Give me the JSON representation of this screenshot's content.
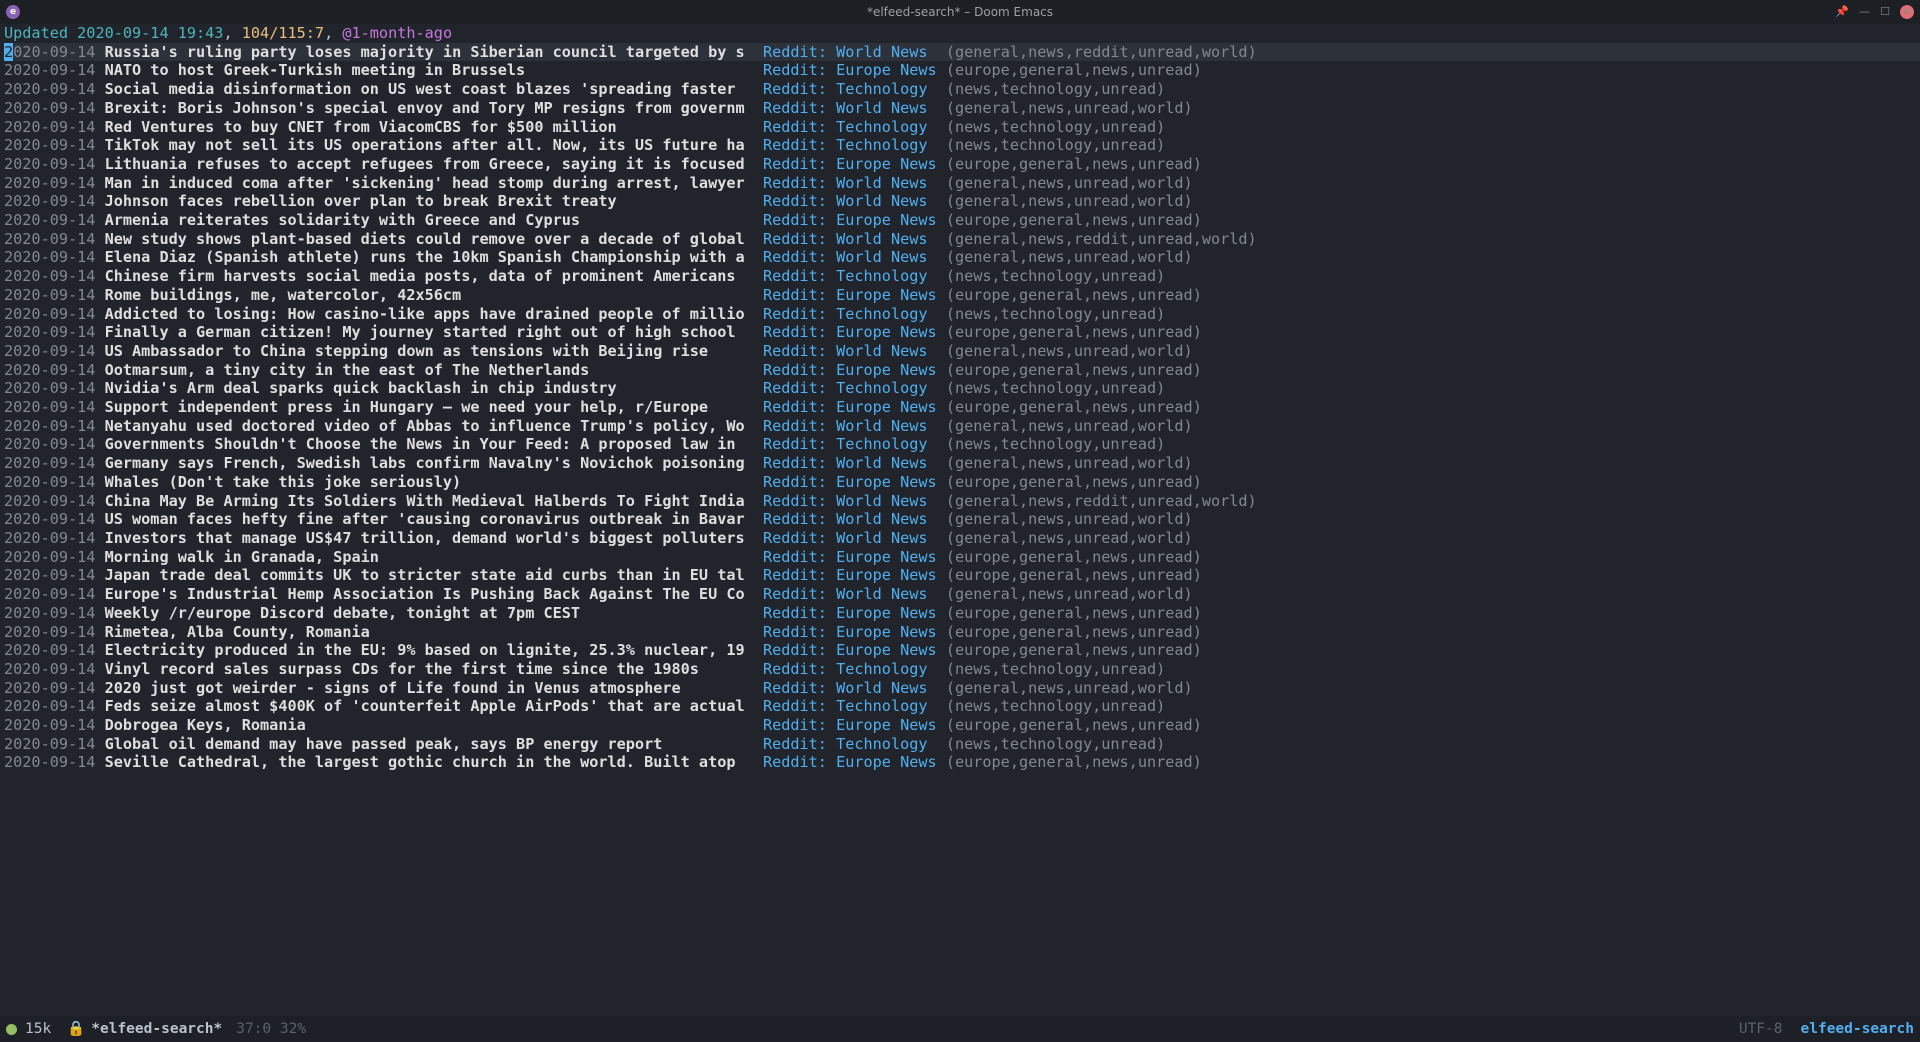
{
  "window": {
    "title": "*elfeed-search* – Doom Emacs"
  },
  "status": {
    "updated_label": "Updated",
    "timestamp": "2020-09-14 19:43",
    "counts": "104/115:7",
    "filter": "@1-month-ago"
  },
  "feeds": {
    "world": "Reddit: World News",
    "europe": "Reddit: Europe News",
    "tech": "Reddit: Technology"
  },
  "tagsets": {
    "world": "(general,news,reddit,unread,world)",
    "world2": "(general,news,unread,world)",
    "europe": "(europe,general,news,unread)",
    "tech": "(news,technology,unread)"
  },
  "entries": [
    {
      "date": "2020-09-14",
      "title": "Russia's ruling party loses majority in Siberian council targeted by s",
      "feedKey": "world",
      "tagKey": "world",
      "hl": true,
      "cursor": true
    },
    {
      "date": "2020-09-14",
      "title": "NATO to host Greek-Turkish meeting in Brussels",
      "feedKey": "europe",
      "tagKey": "europe"
    },
    {
      "date": "2020-09-14",
      "title": "Social media disinformation on US west coast blazes 'spreading faster",
      "feedKey": "tech",
      "tagKey": "tech"
    },
    {
      "date": "2020-09-14",
      "title": "Brexit: Boris Johnson's special envoy and Tory MP resigns from governm",
      "feedKey": "world",
      "tagKey": "world2"
    },
    {
      "date": "2020-09-14",
      "title": "Red Ventures to buy CNET from ViacomCBS for $500 million",
      "feedKey": "tech",
      "tagKey": "tech"
    },
    {
      "date": "2020-09-14",
      "title": "TikTok may not sell its US operations after all. Now, its US future ha",
      "feedKey": "tech",
      "tagKey": "tech"
    },
    {
      "date": "2020-09-14",
      "title": "Lithuania refuses to accept refugees from Greece, saying it is focused",
      "feedKey": "europe",
      "tagKey": "europe"
    },
    {
      "date": "2020-09-14",
      "title": "Man in induced coma after 'sickening' head stomp during arrest, lawyer",
      "feedKey": "world",
      "tagKey": "world2"
    },
    {
      "date": "2020-09-14",
      "title": "Johnson faces rebellion over plan to break Brexit treaty",
      "feedKey": "world",
      "tagKey": "world2"
    },
    {
      "date": "2020-09-14",
      "title": "Armenia reiterates solidarity with Greece and Cyprus",
      "feedKey": "europe",
      "tagKey": "europe"
    },
    {
      "date": "2020-09-14",
      "title": "New study shows plant-based diets could remove over a decade of global",
      "feedKey": "world",
      "tagKey": "world"
    },
    {
      "date": "2020-09-14",
      "title": "Elena Diaz (Spanish athlete) runs the 10km Spanish Championship with a",
      "feedKey": "world",
      "tagKey": "world2"
    },
    {
      "date": "2020-09-14",
      "title": "Chinese firm harvests social media posts, data of prominent Americans",
      "feedKey": "tech",
      "tagKey": "tech"
    },
    {
      "date": "2020-09-14",
      "title": "Rome buildings, me, watercolor, 42x56cm",
      "feedKey": "europe",
      "tagKey": "europe"
    },
    {
      "date": "2020-09-14",
      "title": "Addicted to losing: How casino-like apps have drained people of millio",
      "feedKey": "tech",
      "tagKey": "tech"
    },
    {
      "date": "2020-09-14",
      "title": "Finally a German citizen! My journey started right out of high school",
      "feedKey": "europe",
      "tagKey": "europe"
    },
    {
      "date": "2020-09-14",
      "title": "US Ambassador to China stepping down as tensions with Beijing rise",
      "feedKey": "world",
      "tagKey": "world2"
    },
    {
      "date": "2020-09-14",
      "title": "Ootmarsum, a tiny city in the east of The Netherlands",
      "feedKey": "europe",
      "tagKey": "europe"
    },
    {
      "date": "2020-09-14",
      "title": "Nvidia's Arm deal sparks quick backlash in chip industry",
      "feedKey": "tech",
      "tagKey": "tech"
    },
    {
      "date": "2020-09-14",
      "title": "Support independent press in Hungary – we need your help, r/Europe",
      "feedKey": "europe",
      "tagKey": "europe"
    },
    {
      "date": "2020-09-14",
      "title": "Netanyahu used doctored video of Abbas to influence Trump's policy, Wo",
      "feedKey": "world",
      "tagKey": "world2"
    },
    {
      "date": "2020-09-14",
      "title": "Governments Shouldn't Choose the News in Your Feed: A proposed law in",
      "feedKey": "tech",
      "tagKey": "tech"
    },
    {
      "date": "2020-09-14",
      "title": "Germany says French, Swedish labs confirm Navalny's Novichok poisoning",
      "feedKey": "world",
      "tagKey": "world2"
    },
    {
      "date": "2020-09-14",
      "title": "Whales (Don't take this joke seriously)",
      "feedKey": "europe",
      "tagKey": "europe"
    },
    {
      "date": "2020-09-14",
      "title": "China May Be Arming Its Soldiers With Medieval Halberds To Fight India",
      "feedKey": "world",
      "tagKey": "world"
    },
    {
      "date": "2020-09-14",
      "title": "US woman faces hefty fine after 'causing coronavirus outbreak in Bavar",
      "feedKey": "world",
      "tagKey": "world2"
    },
    {
      "date": "2020-09-14",
      "title": "Investors that manage US$47 trillion, demand world's biggest polluters",
      "feedKey": "world",
      "tagKey": "world2"
    },
    {
      "date": "2020-09-14",
      "title": "Morning walk in Granada, Spain",
      "feedKey": "europe",
      "tagKey": "europe"
    },
    {
      "date": "2020-09-14",
      "title": "Japan trade deal commits UK to stricter state aid curbs than in EU tal",
      "feedKey": "europe",
      "tagKey": "europe"
    },
    {
      "date": "2020-09-14",
      "title": "Europe's Industrial Hemp Association Is Pushing Back Against The EU Co",
      "feedKey": "world",
      "tagKey": "world2"
    },
    {
      "date": "2020-09-14",
      "title": "Weekly /r/europe Discord debate, tonight at 7pm CEST",
      "feedKey": "europe",
      "tagKey": "europe"
    },
    {
      "date": "2020-09-14",
      "title": "Rimetea, Alba County, Romania",
      "feedKey": "europe",
      "tagKey": "europe"
    },
    {
      "date": "2020-09-14",
      "title": "Electricity produced in the EU: 9% based on lignite, 25.3% nuclear, 19",
      "feedKey": "europe",
      "tagKey": "europe"
    },
    {
      "date": "2020-09-14",
      "title": "Vinyl record sales surpass CDs for the first time since the 1980s",
      "feedKey": "tech",
      "tagKey": "tech"
    },
    {
      "date": "2020-09-14",
      "title": "2020 just got weirder - signs of Life found in Venus atmosphere",
      "feedKey": "world",
      "tagKey": "world2"
    },
    {
      "date": "2020-09-14",
      "title": "Feds seize almost $400K of 'counterfeit Apple AirPods' that are actual",
      "feedKey": "tech",
      "tagKey": "tech"
    },
    {
      "date": "2020-09-14",
      "title": "Dobrogea Keys, Romania",
      "feedKey": "europe",
      "tagKey": "europe"
    },
    {
      "date": "2020-09-14",
      "title": "Global oil demand may have passed peak, says BP energy report",
      "feedKey": "tech",
      "tagKey": "tech"
    },
    {
      "date": "2020-09-14",
      "title": "Seville Cathedral, the largest gothic church in the world. Built atop",
      "feedKey": "europe",
      "tagKey": "europe"
    }
  ],
  "modeline": {
    "size": "15k",
    "buffer_name": "*elfeed-search*",
    "position": "37:0 32%",
    "encoding": "UTF-8",
    "major_mode": "elfeed-search"
  },
  "columns": {
    "title_width": 72,
    "feed_width": 20
  }
}
